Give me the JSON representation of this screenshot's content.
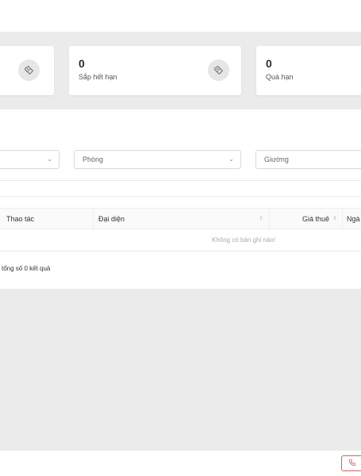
{
  "stats": [
    {
      "value": "0",
      "label": "Sắp hết hạn",
      "icon": "tag-icon"
    },
    {
      "value": "0",
      "label": "Quá hạn",
      "icon": "tag-icon"
    }
  ],
  "filters": {
    "room_placeholder": "Phòng",
    "bed_placeholder": "Giường"
  },
  "table": {
    "columns": [
      "Thao tác",
      "Đại diện",
      "Giá thuê",
      "Ngà"
    ],
    "empty_text": "Không có bản ghi nào!"
  },
  "pagination": {
    "total_text": "tổng số 0 kết quả"
  },
  "colors": {
    "background": "#ebebeb",
    "accent_call": "#e05a5a"
  }
}
